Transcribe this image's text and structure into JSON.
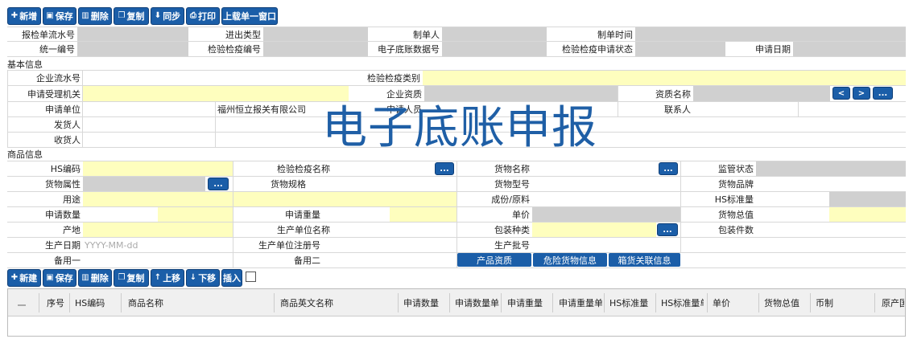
{
  "toolbar": {
    "add": "新增",
    "save": "保存",
    "delete": "删除",
    "copy": "复制",
    "sync": "同步",
    "print": "打印",
    "upload_window": "上载单一窗口"
  },
  "header": {
    "report_serial": "报检单流水号",
    "in_out_type": "进出类型",
    "creator": "制单人",
    "create_time": "制单时间",
    "unified_no": "统一编号",
    "inspection_no": "检验检疫编号",
    "ledger_no": "电子底账数据号",
    "apply_status": "检验检疫申请状态",
    "apply_date": "申请日期"
  },
  "basic": {
    "section": "基本信息",
    "enterprise_serial": "企业流水号",
    "inspection_category": "检验检疫类别",
    "accepting_org": "申请受理机关",
    "enterprise_qualification": "企业资质",
    "qualification_name": "资质名称",
    "applicant": "申请单位",
    "applicant_value": "福州恒立报关有限公司",
    "apply_person": "申请人员",
    "contact": "联系人",
    "consignor": "发货人",
    "consignee": "收货人"
  },
  "watermark": "电子底账申报",
  "goods": {
    "section": "商品信息",
    "hs_code": "HS编码",
    "inspection_name": "检验检疫名称",
    "goods_name": "货物名称",
    "supervision_status": "监管状态",
    "goods_attr": "货物属性",
    "goods_spec": "货物规格",
    "goods_model": "货物型号",
    "goods_brand": "货物品牌",
    "usage": "用途",
    "ingredients": "成份/原料",
    "hs_std_qty": "HS标准量",
    "apply_qty": "申请数量",
    "apply_weight": "申请重量",
    "unit_price": "单价",
    "goods_total": "货物总值",
    "origin": "产地",
    "producer_name": "生产单位名称",
    "pack_type": "包装种类",
    "pack_count": "包装件数",
    "prod_date": "生产日期",
    "prod_date_placeholder": "YYYY-MM-dd",
    "producer_reg_no": "生产单位注册号",
    "batch_no": "生产批号",
    "remark1": "备用一",
    "remark2": "备用二",
    "tab_product_qual": "产品资质",
    "tab_danger": "危险货物信息",
    "tab_container": "箱货关联信息"
  },
  "grid_toolbar": {
    "add": "新建",
    "save": "保存",
    "delete": "删除",
    "copy": "复制",
    "up": "上移",
    "down": "下移",
    "insert": "插入"
  },
  "table": {
    "columns": [
      "序号",
      "HS编码",
      "商品名称",
      "商品英文名称",
      "申请数量",
      "申请数量单",
      "申请重量",
      "申请重量单",
      "HS标准量",
      "HS标准量单",
      "单价",
      "货物总值",
      "币制",
      "原产国"
    ]
  },
  "dots": "...",
  "nav_prev": "<",
  "nav_next": ">",
  "colors": {
    "button": "#1b5ea8",
    "gray_field": "#d0d0d0",
    "yellow_field": "#fefebe",
    "watermark": "#1f5fa6"
  }
}
